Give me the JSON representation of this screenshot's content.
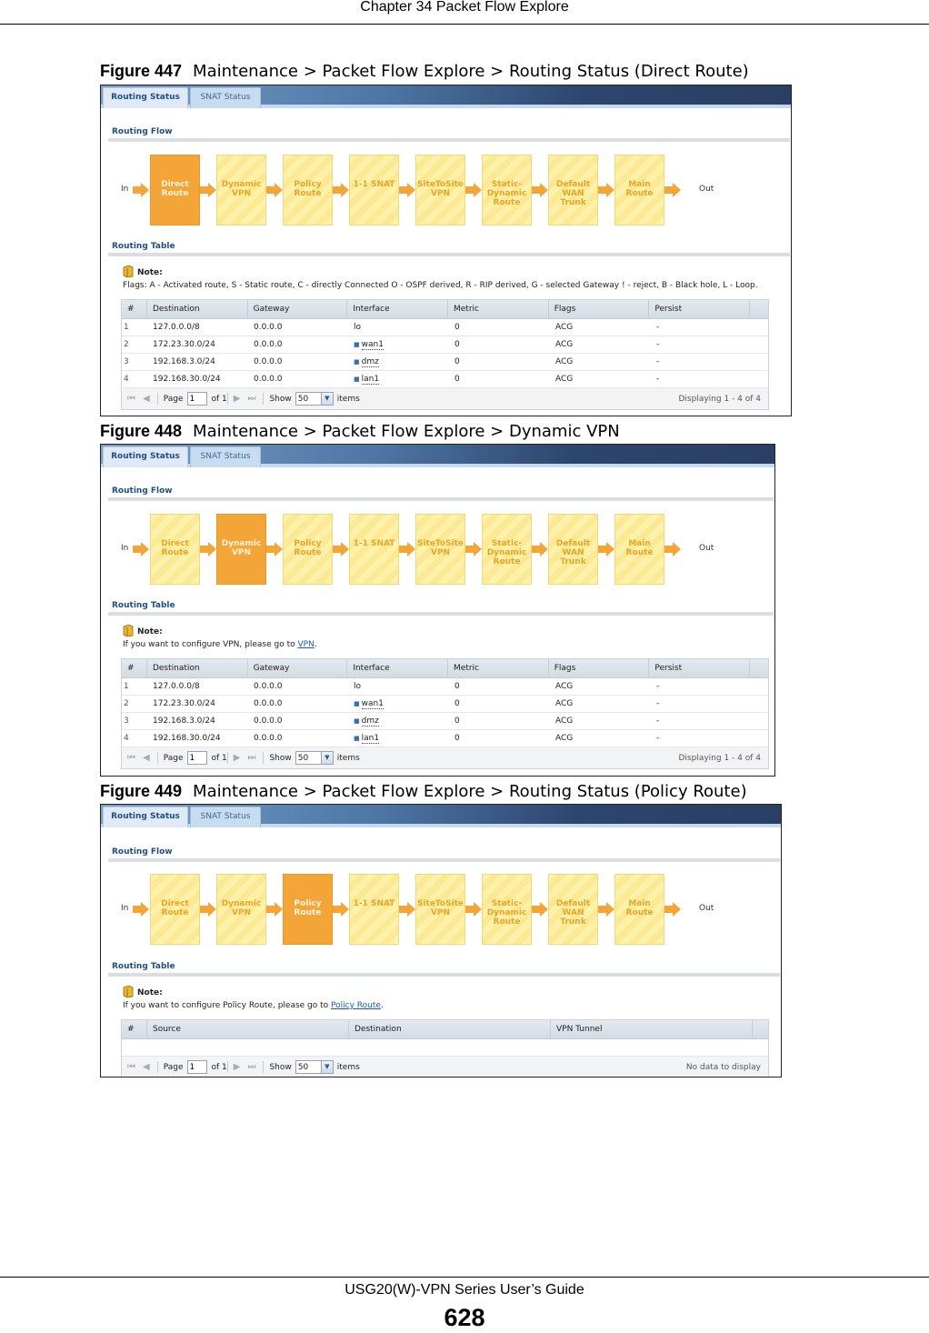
{
  "page": {
    "header": "Chapter 34 Packet Flow Explore",
    "footer_guide": "USG20(W)-VPN Series User’s Guide",
    "page_number": "628"
  },
  "tabs": {
    "routing_status": "Routing Status",
    "snat_status": "SNAT Status"
  },
  "labels": {
    "routing_flow": "Routing Flow",
    "routing_table": "Routing Table",
    "note": "Note:",
    "flow_in": "In",
    "flow_out": "Out"
  },
  "flow_steps": [
    "Direct\nRoute",
    "Dynamic\nVPN",
    "Policy\nRoute",
    "1-1 SNAT",
    "SiteToSite\nVPN",
    "Static-\nDynamic\nRoute",
    "Default\nWAN\nTrunk",
    "Main\nRoute"
  ],
  "colors": {
    "active_step": "#f3a537",
    "inactive_step": "#fff2a8",
    "header_blue": "#1d4f86"
  },
  "pager": {
    "page_label": "Page",
    "page_value": "1",
    "of_label": "of 1",
    "show_label": "Show",
    "show_value": "50",
    "items_label": "items"
  },
  "route_columns": [
    "#",
    "Destination",
    "Gateway",
    "Interface",
    "Metric",
    "Flags",
    "Persist"
  ],
  "route_rows": [
    [
      "1",
      "127.0.0.0/8",
      "0.0.0.0",
      "lo",
      "0",
      "ACG",
      "-"
    ],
    [
      "2",
      "172.23.30.0/24",
      "0.0.0.0",
      "wan1",
      "0",
      "ACG",
      "-"
    ],
    [
      "3",
      "192.168.3.0/24",
      "0.0.0.0",
      "dmz",
      "0",
      "ACG",
      "-"
    ],
    [
      "4",
      "192.168.30.0/24",
      "0.0.0.0",
      "lan1",
      "0",
      "ACG",
      "-"
    ]
  ],
  "figures": [
    {
      "number": "Figure 447",
      "title": "Maintenance > Packet Flow Explore > Routing Status (Direct Route)",
      "active_step": 0,
      "note_text": "Flags: A - Activated route, S - Static route, C - directly Connected O - OSPF derived, R - RIP derived, G - selected Gateway ! - reject, B - Black hole, L - Loop.",
      "displaying": "Displaying 1 - 4 of 4"
    },
    {
      "number": "Figure 448",
      "title": "Maintenance > Packet Flow Explore > Dynamic VPN",
      "active_step": 1,
      "note_prefix": "If you want to configure VPN, please go to ",
      "note_link": "VPN",
      "note_suffix": ".",
      "displaying": "Displaying 1 - 4 of 4"
    },
    {
      "number": "Figure 449",
      "title": "Maintenance > Packet Flow Explore > Routing Status (Policy Route)",
      "active_step": 2,
      "note_prefix": "If you want to configure Policy Route, please go to ",
      "note_link": "Policy Route",
      "note_suffix": ".",
      "policy_columns": [
        "#",
        "Source",
        "Destination",
        "VPN Tunnel"
      ],
      "displaying": "No data to display"
    }
  ]
}
